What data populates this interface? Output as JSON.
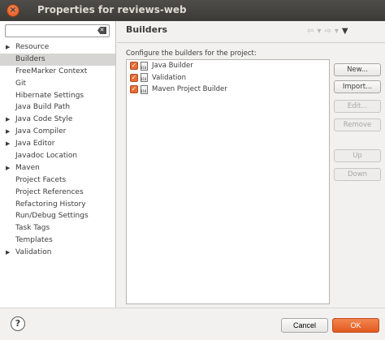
{
  "window": {
    "title": "Properties for reviews-web",
    "close_glyph": "×"
  },
  "filter": {
    "value": "",
    "placeholder": ""
  },
  "tree": {
    "items": [
      {
        "label": "Resource",
        "expandable": true,
        "selected": false
      },
      {
        "label": "Builders",
        "expandable": false,
        "selected": true
      },
      {
        "label": "FreeMarker Context",
        "expandable": false,
        "selected": false
      },
      {
        "label": "Git",
        "expandable": false,
        "selected": false
      },
      {
        "label": "Hibernate Settings",
        "expandable": false,
        "selected": false
      },
      {
        "label": "Java Build Path",
        "expandable": false,
        "selected": false
      },
      {
        "label": "Java Code Style",
        "expandable": true,
        "selected": false
      },
      {
        "label": "Java Compiler",
        "expandable": true,
        "selected": false
      },
      {
        "label": "Java Editor",
        "expandable": true,
        "selected": false
      },
      {
        "label": "Javadoc Location",
        "expandable": false,
        "selected": false
      },
      {
        "label": "Maven",
        "expandable": true,
        "selected": false
      },
      {
        "label": "Project Facets",
        "expandable": false,
        "selected": false
      },
      {
        "label": "Project References",
        "expandable": false,
        "selected": false
      },
      {
        "label": "Refactoring History",
        "expandable": false,
        "selected": false
      },
      {
        "label": "Run/Debug Settings",
        "expandable": false,
        "selected": false
      },
      {
        "label": "Task Tags",
        "expandable": false,
        "selected": false
      },
      {
        "label": "Templates",
        "expandable": false,
        "selected": false
      },
      {
        "label": "Validation",
        "expandable": true,
        "selected": false
      }
    ]
  },
  "page": {
    "title": "Builders",
    "description": "Configure the builders for the project:"
  },
  "builders": [
    {
      "label": "Java Builder",
      "checked": true
    },
    {
      "label": "Validation",
      "checked": true
    },
    {
      "label": "Maven Project Builder",
      "checked": true
    }
  ],
  "buttons": {
    "new": "New...",
    "import": "Import...",
    "edit": "Edit...",
    "remove": "Remove",
    "up": "Up",
    "down": "Down"
  },
  "footer": {
    "help": "?",
    "cancel": "Cancel",
    "ok": "OK"
  },
  "icons": {
    "back": "back-arrow-icon",
    "forward": "forward-arrow-icon",
    "menu": "view-menu-icon"
  },
  "colors": {
    "accent": "#e15a1f",
    "checkbox": "#e76d33",
    "titlebar": "#3c3b37"
  }
}
